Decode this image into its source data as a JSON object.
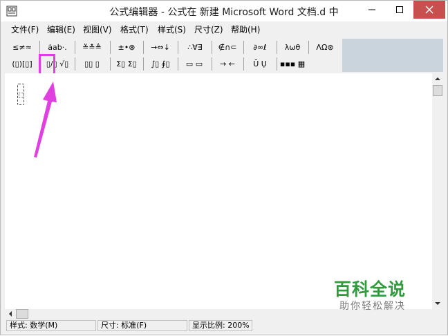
{
  "window": {
    "title": "公式编辑器 - 公式在 新建 Microsoft Word 文档.d 中",
    "min_label": "–",
    "max_label": "□",
    "close_label": "✕"
  },
  "menubar": {
    "items": [
      {
        "label": "文件(F)"
      },
      {
        "label": "编辑(E)"
      },
      {
        "label": "视图(V)"
      },
      {
        "label": "格式(T)"
      },
      {
        "label": "样式(S)"
      },
      {
        "label": "尺寸(Z)"
      },
      {
        "label": "帮助(H)"
      }
    ]
  },
  "palette": {
    "row1": [
      {
        "icon": "≤≠≈"
      },
      {
        "icon": "ȧab·."
      },
      {
        "icon": "≚≛≜"
      },
      {
        "icon": "±•⊗"
      },
      {
        "icon": "→⇔↓"
      },
      {
        "icon": "∴∀∃"
      },
      {
        "icon": "∉∩⊂"
      },
      {
        "icon": "∂∞ℓ"
      },
      {
        "icon": "λωθ"
      },
      {
        "icon": "ΛΩ⊛"
      }
    ],
    "row2": [
      {
        "icon": "(▯)[▯]"
      },
      {
        "icon": "▯/▯ √▯"
      },
      {
        "icon": "▯▯ ▯"
      },
      {
        "icon": "Σ▯ Σ▯"
      },
      {
        "icon": "∫▯ ∮▯"
      },
      {
        "icon": "▭ ▭"
      },
      {
        "icon": "→ ←"
      },
      {
        "icon": "Ū Ụ"
      },
      {
        "icon": "▪▪▪ ▦"
      }
    ]
  },
  "statusbar": {
    "style": "样式: 数学(M)",
    "size": "尺寸: 标准(F)",
    "zoom": "显示比例: 200%"
  },
  "watermark": {
    "title": "百科全说",
    "subtitle": "助你轻松解决"
  },
  "colors": {
    "highlight": "#e040e0",
    "close_button": "#c7504f",
    "watermark_green": "#2f9b3c",
    "toolbar_bg": "#c9d4dd"
  }
}
